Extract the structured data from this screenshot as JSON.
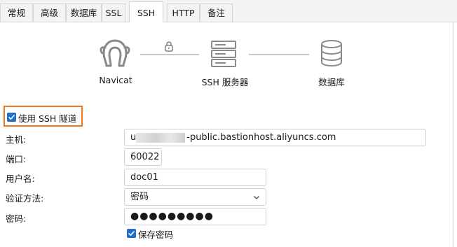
{
  "tabs": [
    {
      "label": "常规"
    },
    {
      "label": "高级"
    },
    {
      "label": "数据库"
    },
    {
      "label": "SSL"
    },
    {
      "label": "SSH"
    },
    {
      "label": "HTTP"
    },
    {
      "label": "备注"
    }
  ],
  "active_tab": "SSH",
  "diagram": {
    "client_label": "Navicat",
    "server_label": "SSH 服务器",
    "database_label": "数据库"
  },
  "use_ssh_tunnel": {
    "label": "使用 SSH 隧道",
    "checked": true
  },
  "form": {
    "host": {
      "label": "主机:",
      "value_prefix": "u",
      "value": "-public.bastionhost.aliyuncs.com"
    },
    "port": {
      "label": "端口:",
      "value": "60022"
    },
    "username": {
      "label": "用户名:",
      "value": "doc01"
    },
    "auth_method": {
      "label": "验证方法:",
      "value": "密码"
    },
    "password": {
      "label": "密码:",
      "value": "●●●●●●●●●"
    },
    "save_password": {
      "label": "保存密码",
      "checked": true
    }
  },
  "colors": {
    "accent": "#1e6fc8",
    "highlight_border": "#f07820"
  }
}
